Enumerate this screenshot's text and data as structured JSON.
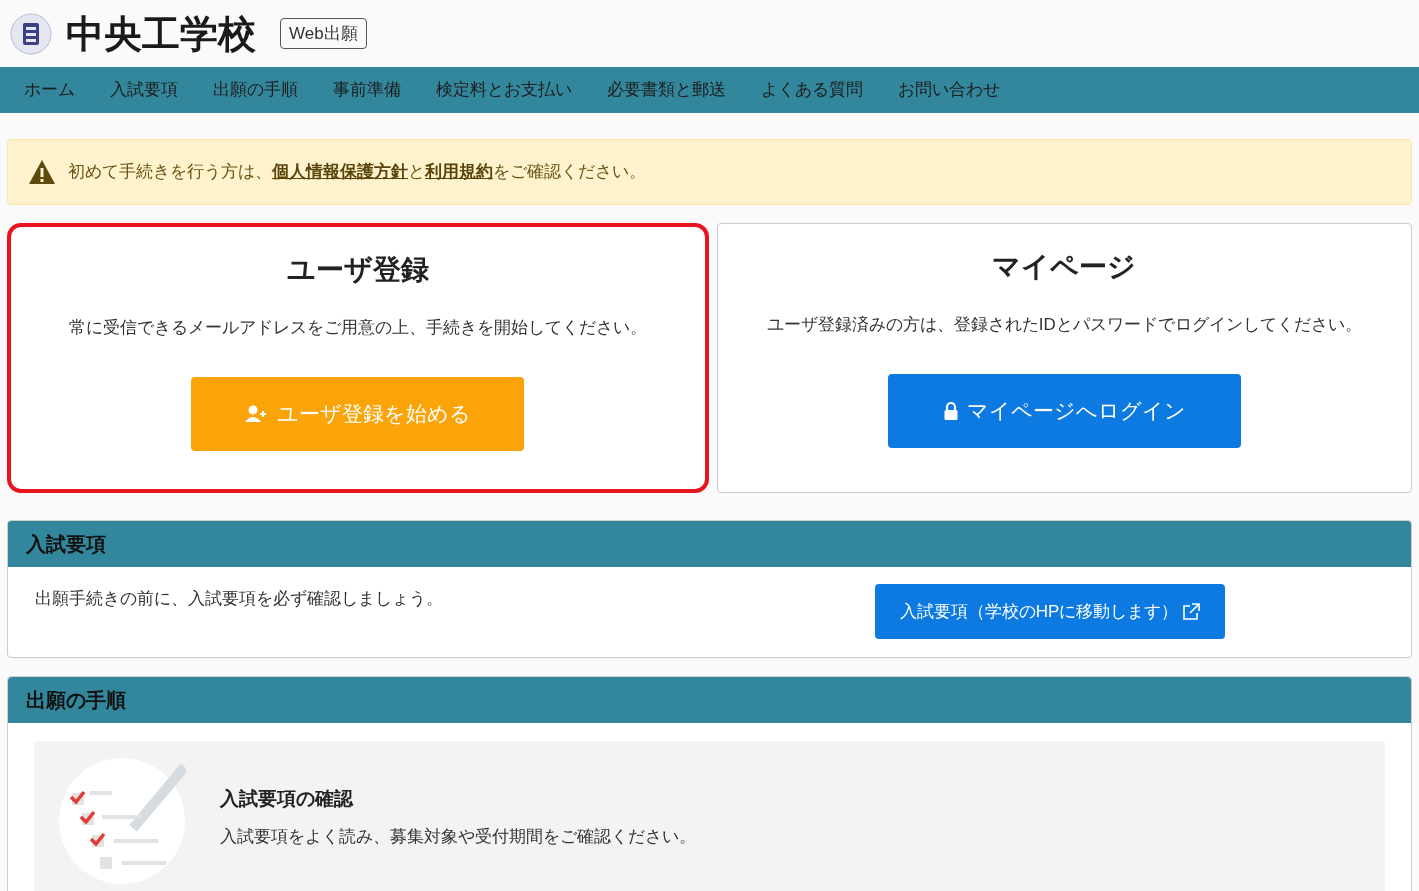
{
  "header": {
    "school_name": "中央工学校",
    "badge": "Web出願"
  },
  "nav": [
    "ホーム",
    "入試要項",
    "出願の手順",
    "事前準備",
    "検定料とお支払い",
    "必要書類と郵送",
    "よくある質問",
    "お問い合わせ"
  ],
  "notice": {
    "parts": [
      {
        "kind": "text",
        "text": "初めて手続きを行う方は、"
      },
      {
        "kind": "link",
        "text": "個人情報保護方針"
      },
      {
        "kind": "text",
        "text": "と"
      },
      {
        "kind": "link",
        "text": "利用規約"
      },
      {
        "kind": "text",
        "text": "をご確認ください。"
      }
    ]
  },
  "cards": [
    {
      "title": "ユーザ登録",
      "description": "常に受信できるメールアドレスをご用意の上、手続きを開始してください。",
      "button": "ユーザ登録を始める",
      "kind": "register",
      "highlighted": true
    },
    {
      "title": "マイページ",
      "description": "ユーザ登録済みの方は、登録されたIDとパスワードでログインしてください。",
      "button": "マイページへログイン",
      "kind": "login",
      "highlighted": false
    }
  ],
  "guidelines": {
    "heading": "入試要項",
    "text": "出願手続きの前に、入試要項を必ず確認しましょう。",
    "button": "入試要項（学校のHPに移動します）"
  },
  "procedure": {
    "heading": "出願の手順",
    "steps": [
      {
        "title": "入試要項の確認",
        "text": "入試要項をよく読み、募集対象や受付期間をご確認ください。"
      }
    ]
  }
}
